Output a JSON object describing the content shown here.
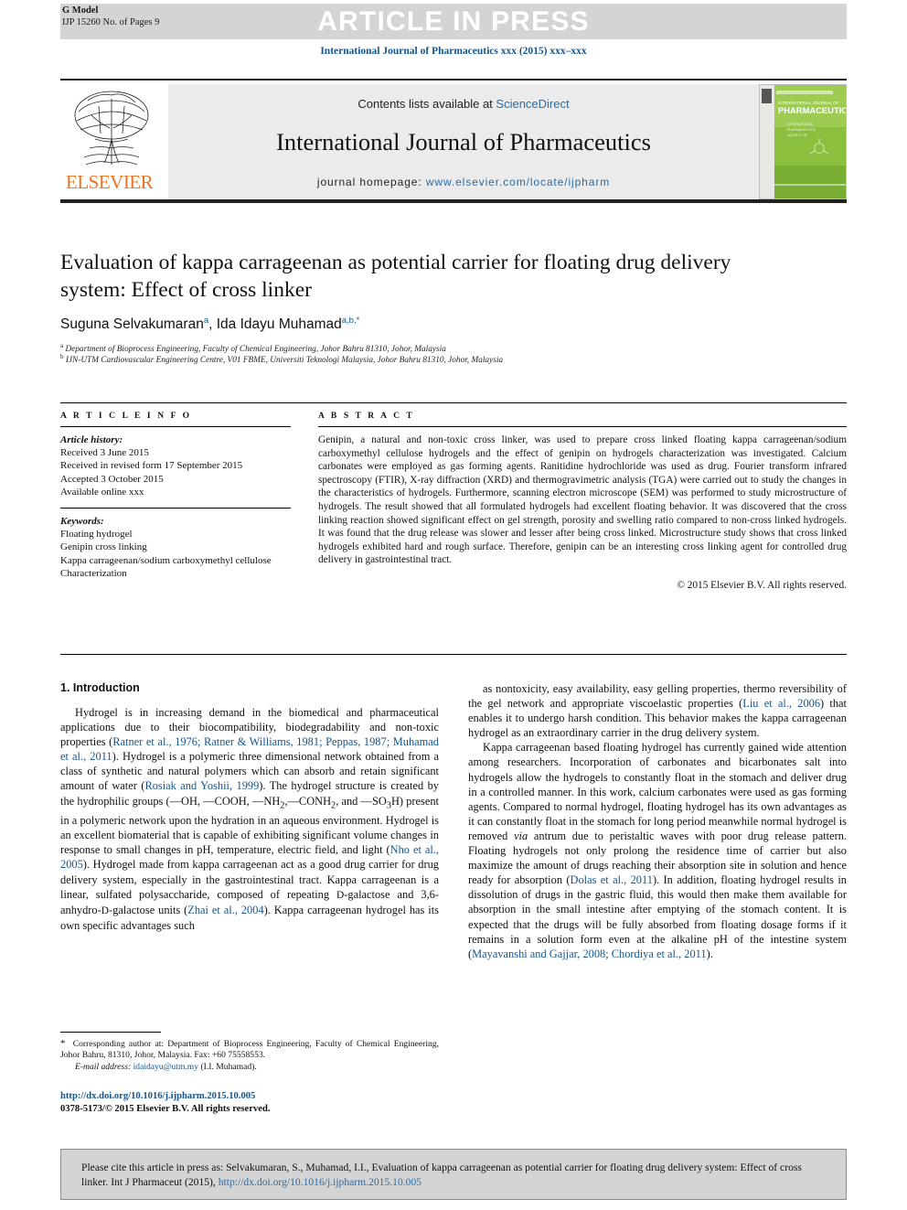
{
  "banner": {
    "text": "ARTICLE IN PRESS",
    "g_model": "G Model",
    "model_sub": "IJP 15260 No. of Pages 9"
  },
  "journal_ref": "International Journal of Pharmaceutics xxx (2015) xxx–xxx",
  "masthead": {
    "contents_prefix": "Contents lists available at ",
    "contents_link": "ScienceDirect",
    "journal_title": "International Journal of Pharmaceutics",
    "homepage_prefix": "journal homepage: ",
    "homepage_url": "www.elsevier.com/locate/ijpharm",
    "publisher": "ELSEVIER",
    "cover_line1": "INTERNATIONAL JOURNAL OF",
    "cover_line2": "PHARMACEUTICS"
  },
  "article": {
    "title": "Evaluation of kappa carrageenan as potential carrier for floating drug delivery system: Effect of cross linker",
    "authors_html": "Suguna Selvakumaran<sup>a</sup>, Ida Idayu Muhamad<sup>a,b,*</sup>",
    "affiliation_a": "Department of Bioprocess Engineering, Faculty of Chemical Engineering, Johor Bahru 81310, Johor, Malaysia",
    "affiliation_b": "IJN-UTM Cardiovascular Engineering Centre, V01 FBME, Universiti Teknologi Malaysia, Johor Bahru 81310, Johor, Malaysia"
  },
  "info": {
    "label": "A R T I C L E   I N F O",
    "history_label": "Article history:",
    "history": [
      "Received 3 June 2015",
      "Received in revised form 17 September 2015",
      "Accepted 3 October 2015",
      "Available online xxx"
    ],
    "keywords_label": "Keywords:",
    "keywords": [
      "Floating hydrogel",
      "Genipin cross linking",
      "Kappa carrageenan/sodium carboxymethyl cellulose",
      "Characterization"
    ]
  },
  "abstract": {
    "label": "A B S T R A C T",
    "text": "Genipin, a natural and non-toxic cross linker, was used to prepare cross linked floating kappa carrageenan/sodium carboxymethyl cellulose hydrogels and the effect of genipin on hydrogels characterization was investigated. Calcium carbonates were employed as gas forming agents. Ranitidine hydrochloride was used as drug. Fourier transform infrared spectroscopy (FTIR), X-ray diffraction (XRD) and thermogravimetric analysis (TGA) were carried out to study the changes in the characteristics of hydrogels. Furthermore, scanning electron microscope (SEM) was performed to study microstructure of hydrogels. The result showed that all formulated hydrogels had excellent floating behavior. It was discovered that the cross linking reaction showed significant effect on gel strength, porosity and swelling ratio compared to non-cross linked hydrogels. It was found that the drug release was slower and lesser after being cross linked. Microstructure study shows that cross linked hydrogels exhibited hard and rough surface. Therefore, genipin can be an interesting cross linking agent for controlled drug delivery in gastrointestinal tract.",
    "copyright": "© 2015 Elsevier B.V. All rights reserved."
  },
  "body": {
    "section_heading": "1. Introduction",
    "left_paragraph_1_html": "Hydrogel is in increasing demand in the biomedical and pharmaceutical applications due to their biocompatibility, biodegradability and non-toxic properties (<span class=\"cit\">Ratner et al., 1976; Ratner &amp; Williams, 1981; Peppas, 1987; Muhamad et al., 2011</span>). Hydrogel is a polymeric three dimensional network obtained from a class of synthetic and natural polymers which can absorb and retain significant amount of water (<span class=\"cit\">Rosiak and Yoshii, 1999</span>). The hydrogel structure is created by the hydrophilic groups (&#8212;OH, &#8212;COOH, &#8212;NH<sub>2</sub>,&#8212;CONH<sub>2</sub>, and &#8212;SO<sub>3</sub>H) present in a polymeric network upon the hydration in an aqueous environment. Hydrogel is an excellent biomaterial that is capable of exhibiting significant volume changes in response to small changes in pH, temperature, electric field, and light (<span class=\"cit\">Nho et al., 2005</span>). Hydrogel made from kappa carrageenan act as a good drug carrier for drug delivery system, especially in the gastrointestinal tract. Kappa carrageenan is a linear, sulfated polysaccharide, composed of repeating <span class=\"sc\">D</span>-galactose and 3,6-anhydro-<span class=\"sc\">D</span>-galactose units (<span class=\"cit\">Zhai et al., 2004</span>). Kappa carrageenan hydrogel has its own specific advantages such",
    "right_paragraph_1_html": "as nontoxicity, easy availability, easy gelling properties, thermo reversibility of the gel network and appropriate viscoelastic properties (<span class=\"cit\">Liu et al., 2006</span>) that enables it to undergo harsh condition. This behavior makes the kappa carrageenan hydrogel as an extraordinary carrier in the drug delivery system.",
    "right_paragraph_2_html": "Kappa carrageenan based floating hydrogel has currently gained wide attention among researchers. Incorporation of carbonates and bicarbonates salt into hydrogels allow the hydrogels to constantly float in the stomach and deliver drug in a controlled manner. In this work, calcium carbonates were used as gas forming agents. Compared to normal hydrogel, floating hydrogel has its own advantages as it can constantly float in the stomach for long period meanwhile normal hydrogel is removed <span class=\"ital\">via</span> antrum due to peristaltic waves with poor drug release pattern. Floating hydrogels not only prolong the residence time of carrier but also maximize the amount of drugs reaching their absorption site in solution and hence ready for absorption (<span class=\"cit\">Dolas et al., 2011</span>). In addition, floating hydrogel results in dissolution of drugs in the gastric fluid, this would then make them available for absorption in the small intestine after emptying of the stomach content. It is expected that the drugs will be fully absorbed from floating dosage forms if it remains in a solution form even at the alkaline pH of the intestine system (<span class=\"cit\">Mayavanshi and Gajjar, 2008; Chordiya et al., 2011</span>)."
  },
  "footnote": {
    "text_html": "<span class=\"star\">*</span>&nbsp; Corresponding author at: Department of Bioprocess Engineering, Faculty of Chemical Engineering, Johor Bahru, 81310, Johor, Malaysia. Fax: +60 75558553.",
    "email_html": "<span class=\"ital\">E-mail address:</span> <span class=\"lnk\">idaidayu@utm.my</span> (I.I. Muhamad)."
  },
  "doi": {
    "url": "http://dx.doi.org/10.1016/j.ijpharm.2015.10.005",
    "issn_line": "0378-5173/© 2015 Elsevier B.V. All rights reserved."
  },
  "citebox": {
    "text_html": "Please cite this article in press as: Selvakumaran, S., Muhamad, I.I., Evaluation of kappa carrageenan as potential carrier for floating drug delivery system: Effect of cross linker. Int J Pharmaceut (2015), <span class=\"lnk\">http://dx.doi.org/10.1016/j.ijpharm.2015.10.005</span>"
  },
  "colors": {
    "link": "#15558d",
    "banner_bg": "#d4d4d4",
    "elsevier_orange": "#e87422"
  }
}
